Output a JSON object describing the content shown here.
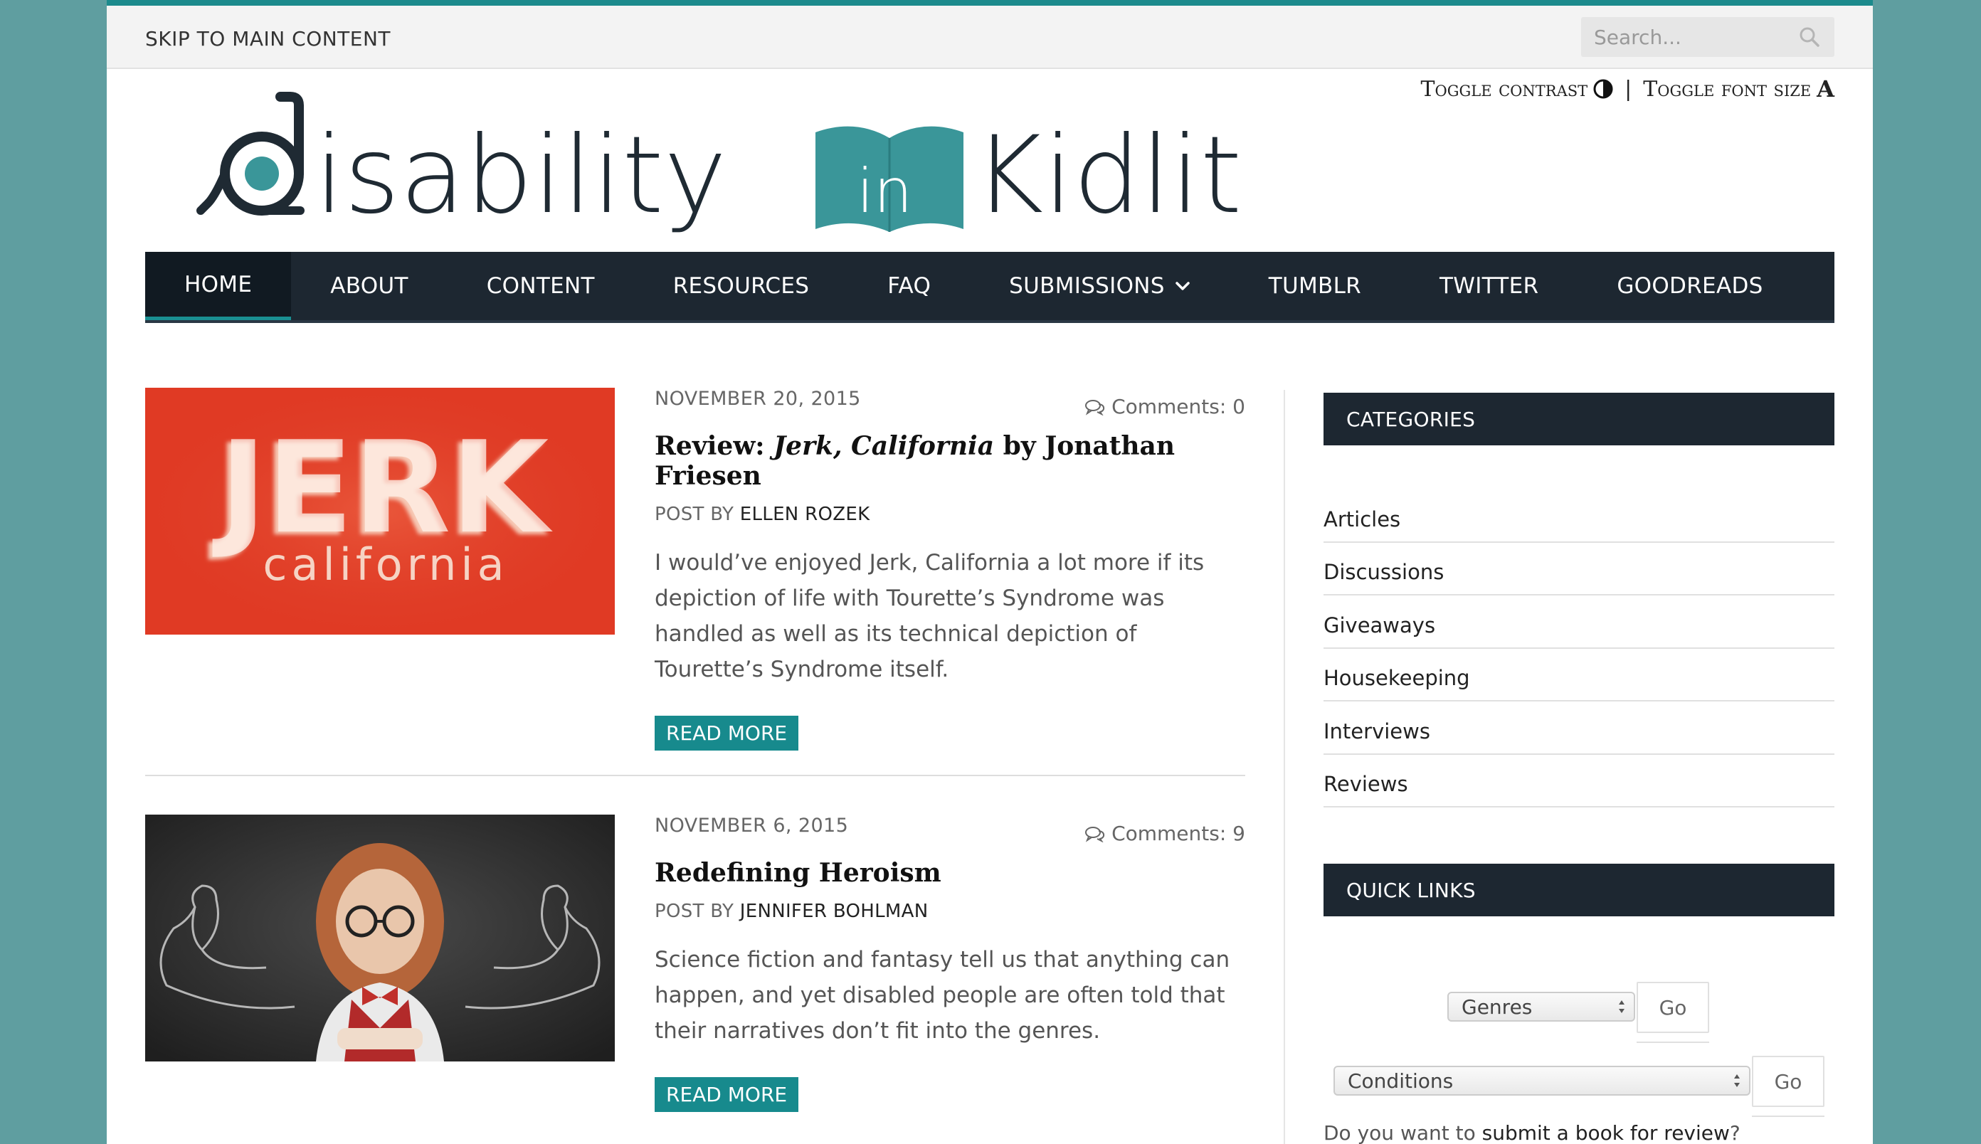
{
  "topbar": {
    "skip_label": "SKIP TO MAIN CONTENT",
    "search_placeholder": "Search..."
  },
  "toggles": {
    "contrast_label": "Toggle contrast",
    "separator": "|",
    "font_size_label": "Toggle font size",
    "font_icon_glyph": "A"
  },
  "logo": {
    "text_left": "isability",
    "text_book": "in",
    "text_right": "Kidlit"
  },
  "nav": {
    "items": [
      {
        "label": "HOME",
        "active": true
      },
      {
        "label": "ABOUT"
      },
      {
        "label": "CONTENT"
      },
      {
        "label": "RESOURCES"
      },
      {
        "label": "FAQ"
      },
      {
        "label": "SUBMISSIONS",
        "has_dropdown": true
      },
      {
        "label": "TUMBLR"
      },
      {
        "label": "TWITTER"
      },
      {
        "label": "GOODREADS"
      }
    ]
  },
  "posts": [
    {
      "date": "NOVEMBER 20, 2015",
      "comments": "Comments: 0",
      "title_prefix": "Review: ",
      "title_italic": "Jerk, California",
      "title_suffix": " by Jonathan Friesen",
      "author_prefix": "POST BY ",
      "author": "ELLEN ROZEK",
      "excerpt": "I would’ve enjoyed Jerk, California a lot more if its depiction of life with Tourette’s Syndrome was handled as well as its technical depiction of Tourette’s Syndrome itself.",
      "read_more": "READ MORE",
      "image_text_big": "JERK",
      "image_text_small": "california"
    },
    {
      "date": "NOVEMBER 6, 2015",
      "comments": "Comments: 9",
      "title": "Redefining Heroism",
      "author_prefix": "POST BY ",
      "author": "JENNIFER BOHLMAN",
      "excerpt": "Science fiction and fantasy tell us that anything can happen, and yet disabled people are often told that their narratives don’t fit into the genres.",
      "read_more": "READ MORE"
    }
  ],
  "sidebar": {
    "categories_title": "CATEGORIES",
    "categories": [
      "Articles",
      "Discussions",
      "Giveaways",
      "Housekeeping",
      "Interviews",
      "Reviews"
    ],
    "quick_links_title": "QUICK LINKS",
    "genres_select": "Genres",
    "conditions_select": "Conditions",
    "go_label": "Go",
    "submit_prefix": "Do you want to ",
    "submit_link": "submit a book for review",
    "submit_suffix": "?"
  },
  "colors": {
    "background": "#5f9ea0",
    "nav": "#1d2731",
    "accent": "#178a8d",
    "jerk_red": "#e23a26"
  },
  "icons": [
    "search-icon",
    "contrast-icon",
    "font-size-icon",
    "chevron-down-icon",
    "comments-icon",
    "select-arrows-icon"
  ]
}
